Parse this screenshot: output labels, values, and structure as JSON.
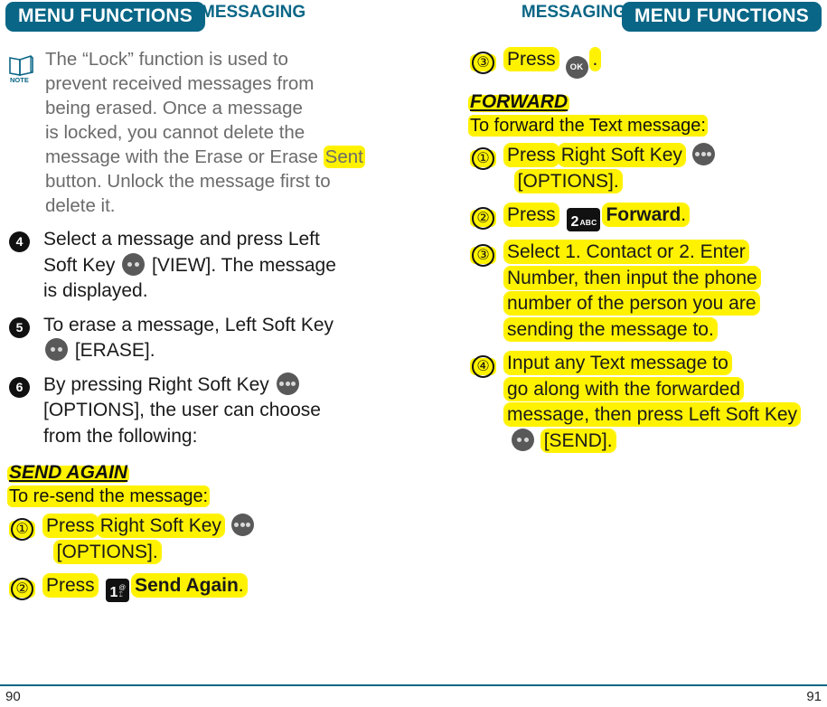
{
  "header": {
    "left_badge": "MENU FUNCTIONS",
    "left_section": "MESSAGING",
    "right_section": "MESSAGING",
    "right_badge": "MENU FUNCTIONS",
    "badge_color": "#0a6686",
    "section_color": "#0a6686"
  },
  "highlight_color": "#fff200",
  "left_column": {
    "note": {
      "icon_label": "NOTE",
      "lines": [
        "The “Lock” function is used to",
        "prevent received messages from",
        "being erased. Once a message",
        "is locked, you cannot delete the",
        "message with the Erase or Erase ",
        "button. Unlock the message first to",
        "delete it."
      ],
      "highlighted_word": "Sent"
    },
    "steps": [
      {
        "number": "4",
        "style": "filled",
        "lines": [
          "Select a message and press Left",
          "Soft Key ",
          " [VIEW]. The message",
          "is displayed."
        ],
        "text": "Select a message and press Left Soft Key [VIEW]. The message is displayed.",
        "key": "left-soft-key"
      },
      {
        "number": "5",
        "style": "filled",
        "text": "To erase a message, Left Soft Key [ERASE].",
        "line1": "To erase a message, Left Soft Key",
        "line2": "[ERASE].",
        "key": "left-soft-key"
      },
      {
        "number": "6",
        "style": "filled",
        "text": "By pressing Right Soft Key [OPTIONS], the user can choose from the following:",
        "line1": "By pressing Right Soft Key",
        "line2": "[OPTIONS], the user can choose",
        "line3": "from the following:",
        "key": "right-soft-key"
      }
    ],
    "option": {
      "title": "SEND AGAIN",
      "subtitle": "To re-send the message:",
      "steps": [
        {
          "number": "①",
          "line1a": "Press",
          "line1b": "Right Soft Key",
          "line2": "[OPTIONS].",
          "key": "right-soft-key"
        },
        {
          "number": "②",
          "line1a": "Press",
          "key": "numeric-key-1",
          "key_digit": "1",
          "key_sub_top": "@",
          "key_sub_bottom": "⑄",
          "line1b": "Send Again",
          "trailing": "."
        }
      ]
    },
    "page_number": "90"
  },
  "right_column": {
    "step_ok": {
      "number": "③",
      "label": "Press",
      "key": "ok-key",
      "key_label": "OK",
      "trailing": "."
    },
    "option": {
      "title": "FORWARD",
      "subtitle": "To forward the Text message:",
      "steps": [
        {
          "number": "①",
          "line1a": "Press",
          "line1b": "Right Soft Key",
          "line2": "[OPTIONS].",
          "key": "right-soft-key"
        },
        {
          "number": "②",
          "line1a": "Press",
          "key": "numeric-key-2",
          "key_digit": "2",
          "key_sub": "ABC",
          "line1b": "Forward",
          "trailing": "."
        },
        {
          "number": "③",
          "line1": "Select 1. Contact or 2. Enter",
          "line2": "Number, then input the phone",
          "line3": "number of the person you are",
          "line4": "sending the message to."
        },
        {
          "number": "④",
          "line1": "Input any Text message to",
          "line2": "go along with the forwarded",
          "line3": "message, then press Left Soft Key",
          "line4": "[SEND].",
          "key": "left-soft-key"
        }
      ]
    },
    "page_number": "91"
  }
}
